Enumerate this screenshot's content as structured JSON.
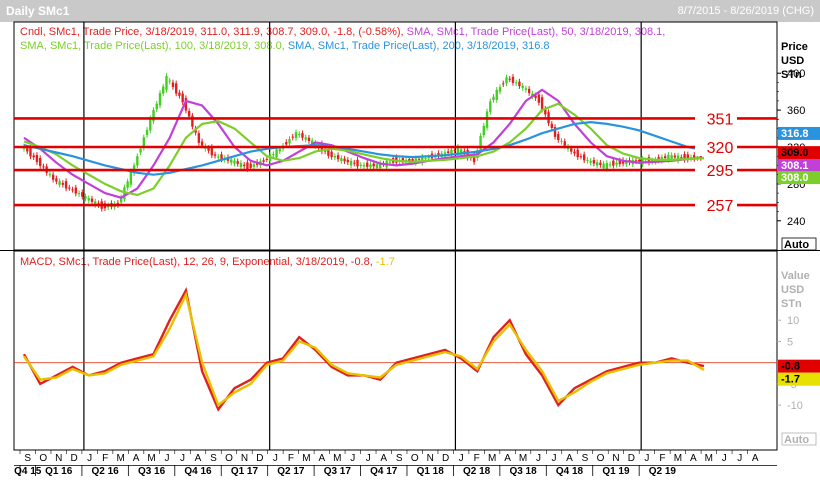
{
  "window": {
    "title": "Daily SMc1",
    "date_range": "8/7/2015 - 8/26/2019 (CHG)"
  },
  "upper_pane": {
    "legend_line1": [
      {
        "text": "Cndl, SMc1, Trade Price, 3/18/2019, 311.0, 311.9, 308.7, 309.0, -1.8, (-0.58%),",
        "color": "#e02020"
      },
      {
        "text": "SMA, SMc1, Trade Price(Last), 50, 3/18/2019, 308.1,",
        "color": "#c040d8"
      }
    ],
    "legend_line2": [
      {
        "text": "SMA, SMc1, Trade Price(Last), 100, 3/18/2019, 308.0,",
        "color": "#7ccf2a"
      },
      {
        "text": "SMA, SMc1, Trade Price(Last), 200, 3/18/2019, 316.8",
        "color": "#2a93dd"
      }
    ],
    "axis_title": [
      "Price",
      "USD",
      "STn"
    ],
    "ticks": [
      "400",
      "360",
      "320",
      "280",
      "240"
    ],
    "tags": [
      {
        "text": "316.8",
        "color": "#2a93dd"
      },
      {
        "text": "309.0",
        "color": "#e00000"
      },
      {
        "text": "308.1",
        "color": "#c040d8"
      },
      {
        "text": "308.0",
        "color": "#7ccf2a"
      }
    ],
    "auto_label": "Auto"
  },
  "lower_pane": {
    "legend_parts": [
      {
        "text": "MACD, SMc1, Trade Price(Last), 12, 26, 9, Exponential, 3/18/2019, -0.8,",
        "color": "#e02020"
      },
      {
        "text": "-1.7",
        "color": "#e8c000"
      }
    ],
    "axis_title": [
      "Value",
      "USD",
      "STn"
    ],
    "ticks": [
      "10",
      "5",
      "-5",
      "-10"
    ],
    "tags": [
      {
        "text": "-0.8",
        "color": "#e00000"
      },
      {
        "text": "-1.7",
        "color": "#e8e000"
      }
    ],
    "auto_label": "Auto"
  },
  "x_axis": {
    "months": [
      "S",
      "O",
      "N",
      "D",
      "J",
      "F",
      "M",
      "A",
      "M",
      "J",
      "J",
      "A",
      "S",
      "O",
      "N",
      "D",
      "J",
      "F",
      "M",
      "A",
      "M",
      "J",
      "J",
      "A",
      "S",
      "O",
      "N",
      "D",
      "J",
      "F",
      "M",
      "A",
      "M",
      "J",
      "J",
      "A",
      "S",
      "O",
      "N",
      "D",
      "J",
      "F",
      "M",
      "A",
      "M",
      "J",
      "J",
      "A"
    ],
    "quarters": [
      "Q4 15",
      "Q1 16",
      "Q2 16",
      "Q3 16",
      "Q4 16",
      "Q1 17",
      "Q2 17",
      "Q3 17",
      "Q4 17",
      "Q1 18",
      "Q2 18",
      "Q3 18",
      "Q4 18",
      "Q1 19",
      "Q2 19"
    ]
  },
  "chart_data": {
    "type": "line",
    "title": "Daily SMc1",
    "x": [
      "2015-09",
      "2015-10",
      "2015-11",
      "2015-12",
      "2016-01",
      "2016-02",
      "2016-03",
      "2016-04",
      "2016-05",
      "2016-06",
      "2016-07",
      "2016-08",
      "2016-09",
      "2016-10",
      "2016-11",
      "2016-12",
      "2017-01",
      "2017-02",
      "2017-03",
      "2017-04",
      "2017-05",
      "2017-06",
      "2017-07",
      "2017-08",
      "2017-09",
      "2017-10",
      "2017-11",
      "2017-12",
      "2018-01",
      "2018-02",
      "2018-03",
      "2018-04",
      "2018-05",
      "2018-06",
      "2018-07",
      "2018-08",
      "2018-09",
      "2018-10",
      "2018-11",
      "2018-12",
      "2019-01",
      "2019-02",
      "2019-03"
    ],
    "price_ylim": [
      230,
      410
    ],
    "price_series": [
      {
        "name": "Cndl Close",
        "color": "#e02020",
        "values": [
          322,
          305,
          285,
          275,
          265,
          255,
          258,
          300,
          350,
          395,
          370,
          325,
          310,
          305,
          298,
          305,
          318,
          335,
          325,
          312,
          305,
          300,
          300,
          305,
          305,
          308,
          312,
          318,
          305,
          370,
          395,
          385,
          370,
          332,
          315,
          305,
          300,
          303,
          305,
          305,
          310,
          308,
          309
        ]
      },
      {
        "name": "SMA 50",
        "color": "#c040d8",
        "values": [
          330,
          318,
          303,
          290,
          280,
          270,
          265,
          275,
          300,
          330,
          370,
          365,
          345,
          320,
          305,
          300,
          305,
          315,
          325,
          322,
          315,
          308,
          302,
          300,
          302,
          305,
          308,
          310,
          312,
          325,
          345,
          370,
          382,
          370,
          345,
          325,
          310,
          305,
          303,
          304,
          305,
          307,
          308.1
        ]
      },
      {
        "name": "SMA 100",
        "color": "#7ccf2a",
        "values": [
          326,
          320,
          312,
          300,
          290,
          280,
          272,
          268,
          275,
          300,
          330,
          345,
          348,
          340,
          325,
          310,
          305,
          308,
          315,
          318,
          316,
          312,
          308,
          305,
          304,
          305,
          306,
          308,
          310,
          315,
          325,
          340,
          360,
          367,
          355,
          340,
          322,
          313,
          308,
          306,
          306,
          307,
          308.0
        ]
      },
      {
        "name": "SMA 200",
        "color": "#2a93dd",
        "values": [
          322,
          318,
          314,
          310,
          305,
          300,
          296,
          292,
          290,
          292,
          296,
          300,
          305,
          310,
          315,
          318,
          320,
          321,
          322,
          321,
          318,
          315,
          312,
          310,
          309,
          310,
          311,
          313,
          315,
          318,
          322,
          328,
          335,
          340,
          345,
          347,
          345,
          342,
          338,
          332,
          326,
          320,
          316.8
        ]
      }
    ],
    "support_resistance_lines": [
      351,
      320,
      295,
      257
    ],
    "macd_ylim": [
      -13.5,
      19
    ],
    "macd_series": [
      {
        "name": "MACD",
        "color": "#e02020",
        "values": [
          2,
          -5,
          -3,
          -1,
          -3,
          -2,
          0,
          1,
          2,
          10,
          17,
          -2,
          -11,
          -6,
          -4,
          0,
          1,
          6,
          3,
          -1,
          -3,
          -3,
          -4,
          0,
          1,
          2,
          3,
          1,
          -2,
          6,
          10,
          2,
          -3,
          -10,
          -6,
          -4,
          -2,
          -1,
          0,
          0,
          1,
          0,
          -0.8
        ]
      },
      {
        "name": "Signal",
        "color": "#e8c000",
        "values": [
          1.5,
          -4,
          -3.5,
          -1.5,
          -3,
          -2.5,
          -0.5,
          0.5,
          1.5,
          8,
          16,
          0,
          -10,
          -7,
          -5,
          -0.5,
          0.5,
          5,
          3.5,
          -0.5,
          -2.5,
          -3,
          -3.5,
          -0.5,
          0.5,
          1.5,
          2.5,
          1.5,
          -1.5,
          5,
          9,
          3,
          -2,
          -9,
          -7,
          -4.5,
          -2.5,
          -1.5,
          -0.5,
          0,
          0.5,
          0.5,
          -1.7
        ]
      }
    ],
    "annotations": [
      "351",
      "320",
      "295",
      "257"
    ]
  }
}
